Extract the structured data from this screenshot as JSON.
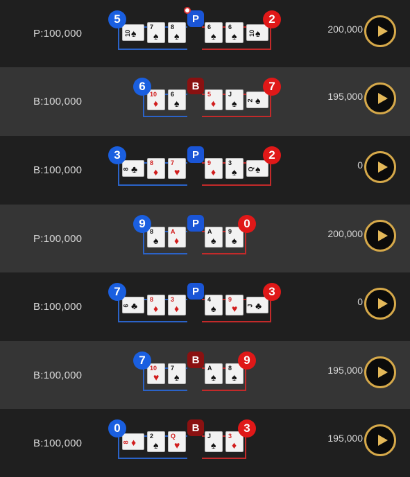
{
  "rows": [
    {
      "bet": "P:100,000",
      "winner": "P",
      "player_score": "5",
      "banker_score": "2",
      "payout": "200,000",
      "player_cards": [
        {
          "rank": "10",
          "suit": "♠",
          "color": "black",
          "side": true
        },
        {
          "rank": "7",
          "suit": "♠",
          "color": "black"
        },
        {
          "rank": "8",
          "suit": "♠",
          "color": "black"
        }
      ],
      "banker_cards": [
        {
          "rank": "6",
          "suit": "♠",
          "color": "black"
        },
        {
          "rank": "6",
          "suit": "♠",
          "color": "black"
        },
        {
          "rank": "10",
          "suit": "♠",
          "color": "black",
          "side": true
        }
      ]
    },
    {
      "bet": "B:100,000",
      "winner": "B",
      "player_score": "6",
      "banker_score": "7",
      "payout": "195,000",
      "player_cards": [
        {
          "rank": "10",
          "suit": "♦",
          "color": "red"
        },
        {
          "rank": "6",
          "suit": "♠",
          "color": "black"
        }
      ],
      "banker_cards": [
        {
          "rank": "5",
          "suit": "♦",
          "color": "red"
        },
        {
          "rank": "J",
          "suit": "♠",
          "color": "black"
        },
        {
          "rank": "2",
          "suit": "♠",
          "color": "black",
          "side": true
        }
      ]
    },
    {
      "bet": "B:100,000",
      "winner": "P",
      "player_score": "3",
      "banker_score": "2",
      "payout": "0",
      "player_cards": [
        {
          "rank": "8",
          "suit": "♣",
          "color": "black",
          "side": true
        },
        {
          "rank": "8",
          "suit": "♦",
          "color": "red"
        },
        {
          "rank": "7",
          "suit": "♥",
          "color": "red"
        }
      ],
      "banker_cards": [
        {
          "rank": "9",
          "suit": "♦",
          "color": "red"
        },
        {
          "rank": "3",
          "suit": "♠",
          "color": "black"
        },
        {
          "rank": "Q",
          "suit": "♠",
          "color": "black",
          "side": true
        }
      ]
    },
    {
      "bet": "P:100,000",
      "winner": "P",
      "player_score": "9",
      "banker_score": "0",
      "payout": "200,000",
      "player_cards": [
        {
          "rank": "8",
          "suit": "♠",
          "color": "black"
        },
        {
          "rank": "A",
          "suit": "♦",
          "color": "red"
        }
      ],
      "banker_cards": [
        {
          "rank": "A",
          "suit": "♠",
          "color": "black"
        },
        {
          "rank": "9",
          "suit": "♠",
          "color": "black"
        }
      ]
    },
    {
      "bet": "B:100,000",
      "winner": "P",
      "player_score": "7",
      "banker_score": "3",
      "payout": "0",
      "player_cards": [
        {
          "rank": "6",
          "suit": "♣",
          "color": "black",
          "side": true
        },
        {
          "rank": "8",
          "suit": "♦",
          "color": "red"
        },
        {
          "rank": "3",
          "suit": "♦",
          "color": "red"
        }
      ],
      "banker_cards": [
        {
          "rank": "4",
          "suit": "♠",
          "color": "black"
        },
        {
          "rank": "9",
          "suit": "♥",
          "color": "red"
        },
        {
          "rank": "J",
          "suit": "♣",
          "color": "black",
          "side": true
        }
      ]
    },
    {
      "bet": "B:100,000",
      "winner": "B",
      "player_score": "7",
      "banker_score": "9",
      "payout": "195,000",
      "player_cards": [
        {
          "rank": "10",
          "suit": "♥",
          "color": "red"
        },
        {
          "rank": "7",
          "suit": "♠",
          "color": "black"
        }
      ],
      "banker_cards": [
        {
          "rank": "A",
          "suit": "♠",
          "color": "black"
        },
        {
          "rank": "8",
          "suit": "♠",
          "color": "black"
        }
      ]
    },
    {
      "bet": "B:100,000",
      "winner": "B",
      "player_score": "0",
      "banker_score": "3",
      "payout": "195,000",
      "player_cards": [
        {
          "rank": "8",
          "suit": "♦",
          "color": "red",
          "side": true
        },
        {
          "rank": "2",
          "suit": "♠",
          "color": "black"
        },
        {
          "rank": "Q",
          "suit": "♥",
          "color": "red"
        }
      ],
      "banker_cards": [
        {
          "rank": "J",
          "suit": "♠",
          "color": "black"
        },
        {
          "rank": "3",
          "suit": "♦",
          "color": "red"
        }
      ]
    }
  ],
  "colors": {
    "player": "#1a5fe0",
    "banker": "#e01818",
    "banker_badge": "#8a1111",
    "play_ring": "#d6a94a"
  }
}
